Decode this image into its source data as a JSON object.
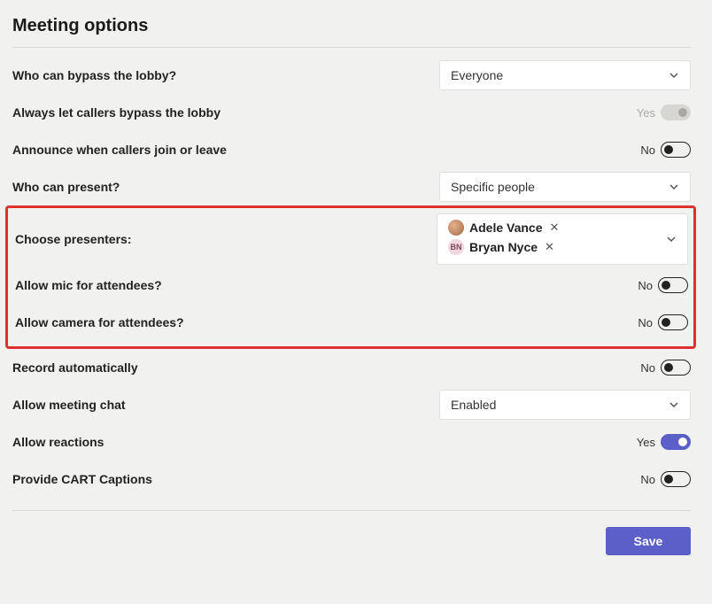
{
  "title": "Meeting options",
  "labels": {
    "bypass_lobby": "Who can bypass the lobby?",
    "callers_bypass": "Always let callers bypass the lobby",
    "announce_callers": "Announce when callers join or leave",
    "who_present": "Who can present?",
    "choose_presenters": "Choose presenters:",
    "allow_mic": "Allow mic for attendees?",
    "allow_camera": "Allow camera for attendees?",
    "record_auto": "Record automatically",
    "allow_chat": "Allow meeting chat",
    "allow_reactions": "Allow reactions",
    "cart_captions": "Provide CART Captions"
  },
  "values": {
    "bypass_lobby": "Everyone",
    "callers_bypass": {
      "on": true,
      "disabled": true,
      "text": "Yes"
    },
    "announce_callers": {
      "on": false,
      "text": "No"
    },
    "who_present": "Specific people",
    "presenters": [
      {
        "name": "Adele Vance",
        "initials": ""
      },
      {
        "name": "Bryan Nyce",
        "initials": "BN"
      }
    ],
    "allow_mic": {
      "on": false,
      "text": "No"
    },
    "allow_camera": {
      "on": false,
      "text": "No"
    },
    "record_auto": {
      "on": false,
      "text": "No"
    },
    "allow_chat": "Enabled",
    "allow_reactions": {
      "on": true,
      "text": "Yes"
    },
    "cart_captions": {
      "on": false,
      "text": "No"
    }
  },
  "buttons": {
    "save": "Save"
  }
}
